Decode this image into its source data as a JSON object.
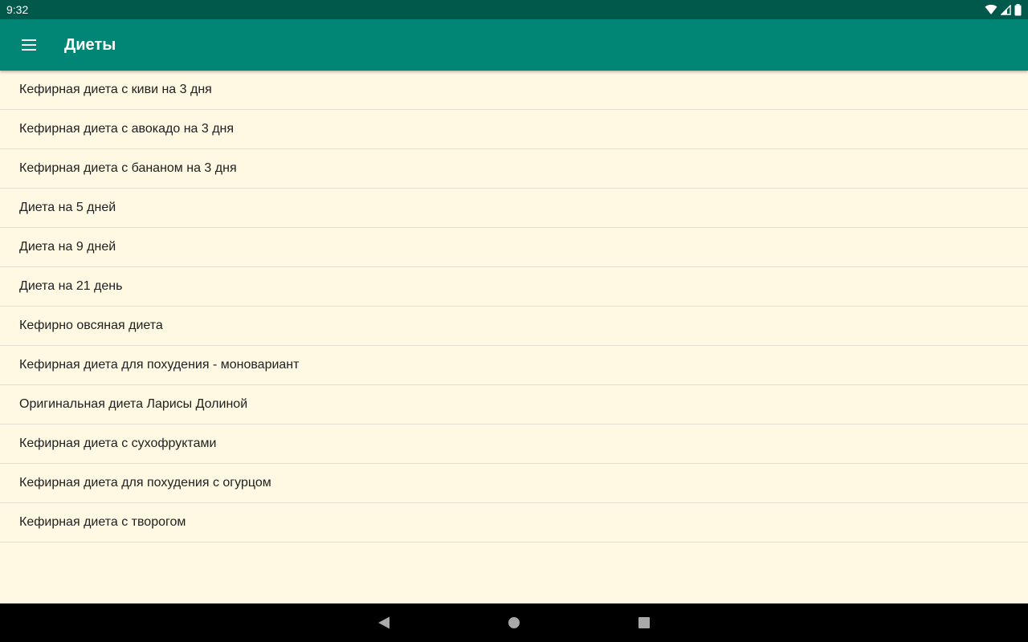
{
  "status_bar": {
    "time": "9:32",
    "icons": [
      "wifi-icon",
      "cell-signal-icon",
      "battery-icon"
    ]
  },
  "app_bar": {
    "title": "Диеты",
    "menu_icon": "hamburger-menu-icon",
    "color": "#018675"
  },
  "list": {
    "items": [
      {
        "label": "Кефирная диета с киви на 3 дня"
      },
      {
        "label": "Кефирная диета с авокадо на 3 дня"
      },
      {
        "label": "Кефирная диета с бананом на 3 дня"
      },
      {
        "label": "Диета на 5 дней"
      },
      {
        "label": "Диета на 9 дней"
      },
      {
        "label": "Диета на 21 день"
      },
      {
        "label": "Кефирно овсяная диета"
      },
      {
        "label": "Кефирная диета для похудения - моновариант"
      },
      {
        "label": "Оригинальная диета Ларисы Долиной"
      },
      {
        "label": "Кефирная диета с сухофруктами"
      },
      {
        "label": "Кефирная диета для похудения с огурцом"
      },
      {
        "label": "Кефирная диета с творогом"
      }
    ]
  },
  "nav_bar": {
    "buttons": [
      "back-icon",
      "home-icon",
      "recents-icon"
    ]
  },
  "colors": {
    "status_bar": "#00594a",
    "background": "#fff8e3",
    "divider": "#e2ddd0"
  }
}
